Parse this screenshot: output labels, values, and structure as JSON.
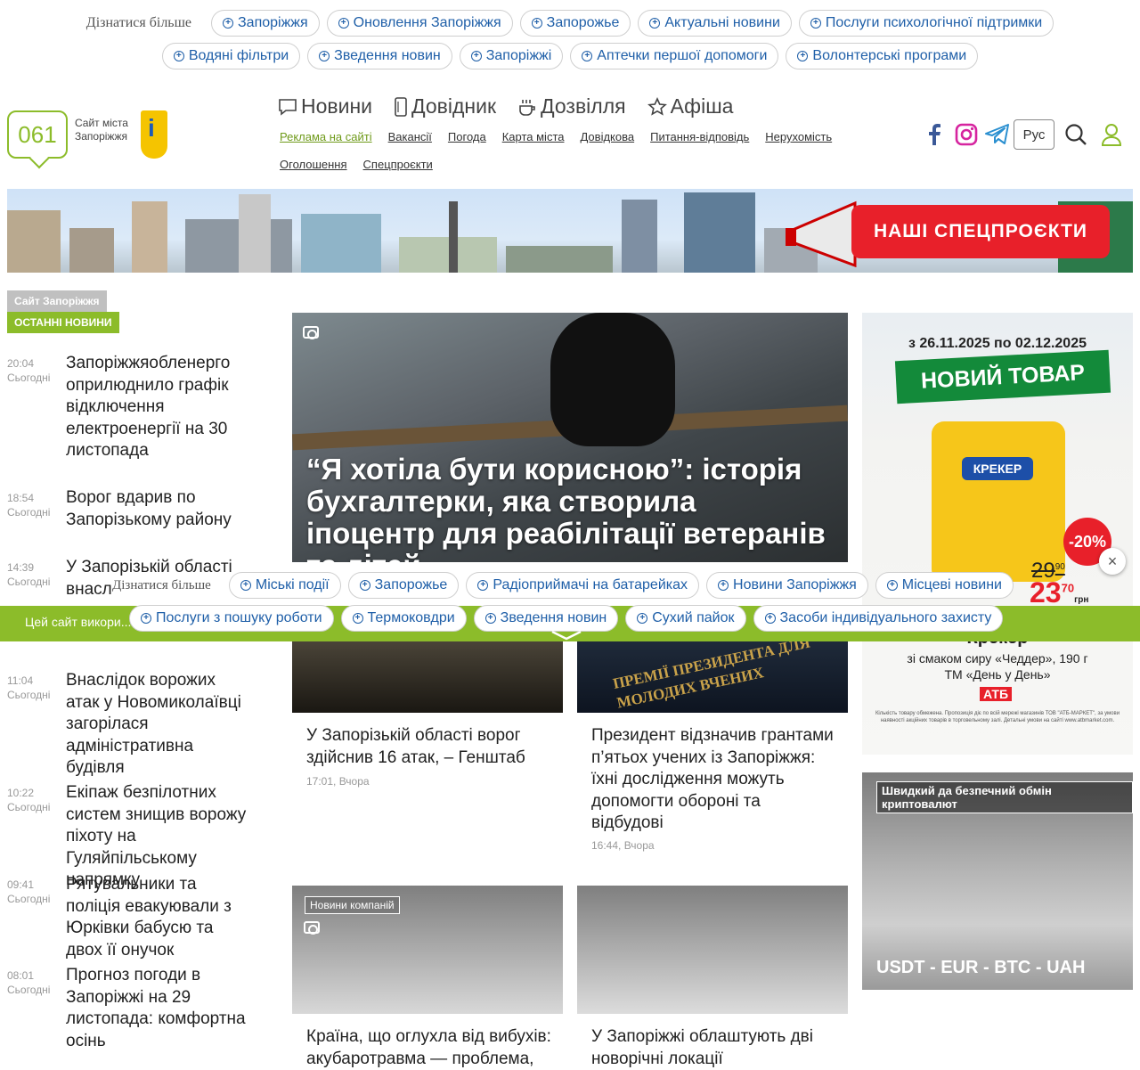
{
  "top_tags": {
    "lead": "Дізнатися більше",
    "row1": [
      "Запоріжжя",
      "Оновлення Запоріжжя",
      "Запорожье",
      "Актуальні новини",
      "Послуги психологічної підтримки"
    ],
    "row2": [
      "Водяні фільтри",
      "Зведення новин",
      "Запоріжжі",
      "Аптечки першої допомоги",
      "Волонтерські програми"
    ]
  },
  "logo": {
    "number": "061",
    "line1": "Сайт міста",
    "line2": "Запоріжжя"
  },
  "mainnav": [
    "Новини",
    "Довідник",
    "Дозвілля",
    "Афіша"
  ],
  "subnav1": [
    "Реклама на сайті",
    "Вакансії",
    "Погода",
    "Карта міста",
    "Довідкова",
    "Питання-відповідь",
    "Нерухомість"
  ],
  "subnav2": [
    "Оголошення",
    "Спецпроєкти"
  ],
  "lang": "Рус",
  "banner": {
    "button": "НАШІ СПЕЦПРОЄКТИ"
  },
  "left": {
    "label1": "Сайт Запоріжжя",
    "label2": "ОСТАННІ НОВИНИ",
    "items": [
      {
        "time": "20:04",
        "day": "Сьогодні",
        "title": "Запоріжжяобленерго оприлюднило графік відключення електроенергії на 30 листопада"
      },
      {
        "time": "18:54",
        "day": "Сьогодні",
        "title": "Ворог вдарив по Запорізькому району"
      },
      {
        "time": "14:39",
        "day": "Сьогодні",
        "title": "У Запорізькій області внасл"
      },
      {
        "time": "11:04",
        "day": "Сьогодні",
        "title": "Внаслідок ворожих атак у Новомиколаївці загорілася адміністративна будівля"
      },
      {
        "time": "10:22",
        "day": "Сьогодні",
        "title": "Екіпаж безпілотних систем знищив ворожу піхоту на Гуляйпільському напрямку"
      },
      {
        "time": "09:41",
        "day": "Сьогодні",
        "title": "Рятувальники та поліція евакуювали з Юрківки бабусю та двох її онучок"
      },
      {
        "time": "08:01",
        "day": "Сьогодні",
        "title": "Прогноз погоди в Запоріжжі на 29 листопада: комфортна осінь"
      }
    ]
  },
  "hero": {
    "title": "“Я хотіла бути корисною”: історія бухгалтерки, яка створила іпоцентр для реабілітації ветеранів та дітей"
  },
  "cards": [
    {
      "title": "У Запорізькій області ворог здійснив 16 атак, – Генштаб",
      "meta": "17:01, Вчора",
      "img_text": ""
    },
    {
      "title": "Президент відзначив грантами п’ятьох учених із Запоріжжя: їхні дослідження можуть допомогти обороні та відбудові",
      "meta": "16:44, Вчора",
      "img_text": "ПРЕМІЇ ПРЕЗИДЕНТА ДЛЯ МОЛОДИХ ВЧЕНИХ"
    },
    {
      "title": "Країна, що оглухла від вибухів: акубаротравма — проблема,",
      "badge": "Новини компаній"
    },
    {
      "title": "У Запоріжжі облаштують дві новорічні локації"
    }
  ],
  "ad1": {
    "dates": "з 26.11.2025 по 02.12.2025",
    "ribbon": "НОВИЙ ТОВАР",
    "product": "КРЕКЕР",
    "discount": "-20%",
    "old_price": "29",
    "old_cents": "90",
    "new_price": "23",
    "new_cents": "70",
    "currency": "грн",
    "name": "Крекер",
    "desc1": "зі смаком сиру «Чеддер», 190 г",
    "desc2": "ТМ «День у День»",
    "brand": "АТБ",
    "fine": "Кількість товару обмежена. Пропозиція діє по всій мережі магазинів ТОВ \"АТБ-МАРКЕТ\", за умови наявності акційних товарів в торговельному залі. Детальні умови на сайті www.atbmarket.com."
  },
  "ad2": {
    "label": "Швидкий да безпечний обмін криптовалют",
    "title": "USDT - EUR - BTC - UAH"
  },
  "cookie": {
    "text": "Цей сайт викори... для збору статистичної і..."
  },
  "overlay_tags": {
    "lead": "Дізнатися більше",
    "row1": [
      "Міські події",
      "Запорожье",
      "Радіоприймачі на батарейках",
      "Новини Запоріжжя",
      "Місцеві новини"
    ],
    "row2": [
      "Послуги з пошуку роботи",
      "Термоковдри",
      "Зведення новин",
      "Сухий пайок",
      "Засоби індивідуального захисту"
    ]
  },
  "colors": {
    "accent": "#8cbc2a",
    "link": "#1f5fa8",
    "red": "#e8202a"
  },
  "icons": [
    "facebook-icon",
    "instagram-icon",
    "telegram-icon",
    "search-icon",
    "user-icon",
    "camera-icon",
    "close-icon"
  ]
}
